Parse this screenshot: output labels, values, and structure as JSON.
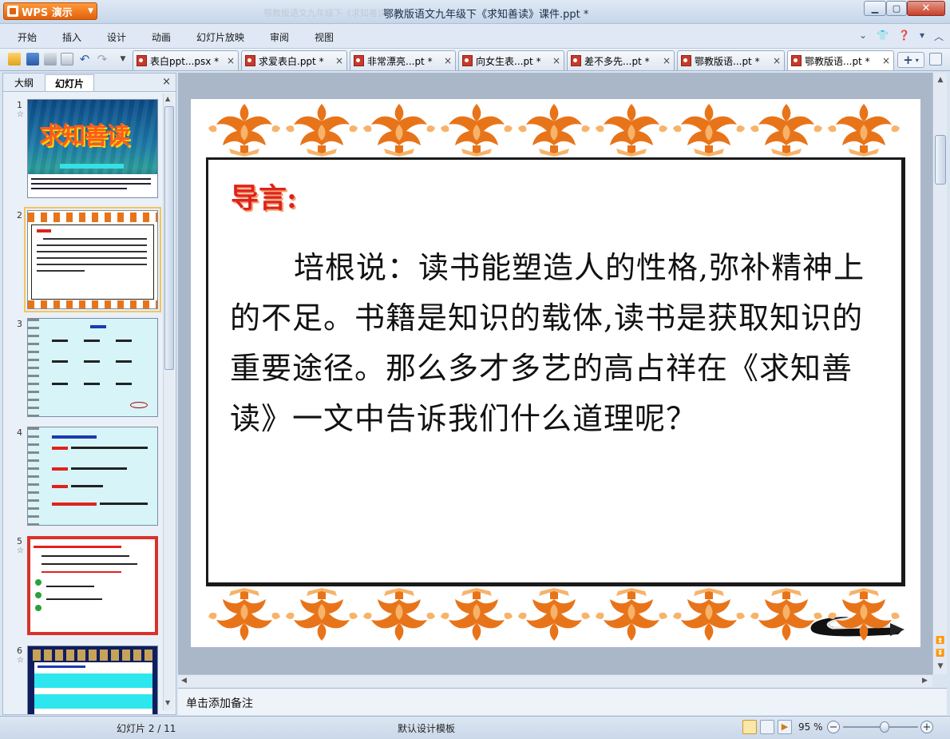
{
  "window": {
    "app_button": "WPS 演示",
    "ghost_text": "鄂教版语文九年级下《求知善读",
    "title": "鄂教版语文九年级下《求知善读》课件.ppt *"
  },
  "menu": {
    "items": [
      "开始",
      "插入",
      "设计",
      "动画",
      "幻灯片放映",
      "审阅",
      "视图"
    ]
  },
  "tabs": [
    {
      "label": "表白ppt...psx *",
      "close": "×"
    },
    {
      "label": "求爱表白.ppt *",
      "close": "×"
    },
    {
      "label": "非常漂亮...pt *",
      "close": "×"
    },
    {
      "label": "向女生表...pt *",
      "close": "×"
    },
    {
      "label": "差不多先...pt *",
      "close": "×"
    },
    {
      "label": "鄂教版语...pt *",
      "close": "×"
    },
    {
      "label": "鄂教版语...pt *",
      "close": "×",
      "active": true
    }
  ],
  "panel": {
    "tab_outline": "大纲",
    "tab_slides": "幻灯片",
    "close": "×",
    "thumbnails": [
      {
        "num": "1",
        "star": "☆",
        "title": "求知善读"
      },
      {
        "num": "2",
        "star": "",
        "selected": true
      },
      {
        "num": "3",
        "star": ""
      },
      {
        "num": "4",
        "star": ""
      },
      {
        "num": "5",
        "star": "☆"
      },
      {
        "num": "6",
        "star": "☆"
      }
    ]
  },
  "slide": {
    "heading": "导言:",
    "body": "培根说：读书能塑造人的性格,弥补精神上的不足。书籍是知识的载体,读书是获取知识的重要途径。那么多才多艺的高占祥在《求知善读》一文中告诉我们什么道理呢？"
  },
  "notes": {
    "placeholder": "单击添加备注"
  },
  "status": {
    "slide_info": "幻灯片 2 / 11",
    "template": "默认设计模板",
    "zoom": "95 %",
    "zoom_fraction": 0.55
  },
  "colors": {
    "ornament_orange": "#e8741a",
    "ornament_light": "#f7b36a",
    "heading_red": "#e0221c",
    "selection_gold": "#f4c55c"
  }
}
